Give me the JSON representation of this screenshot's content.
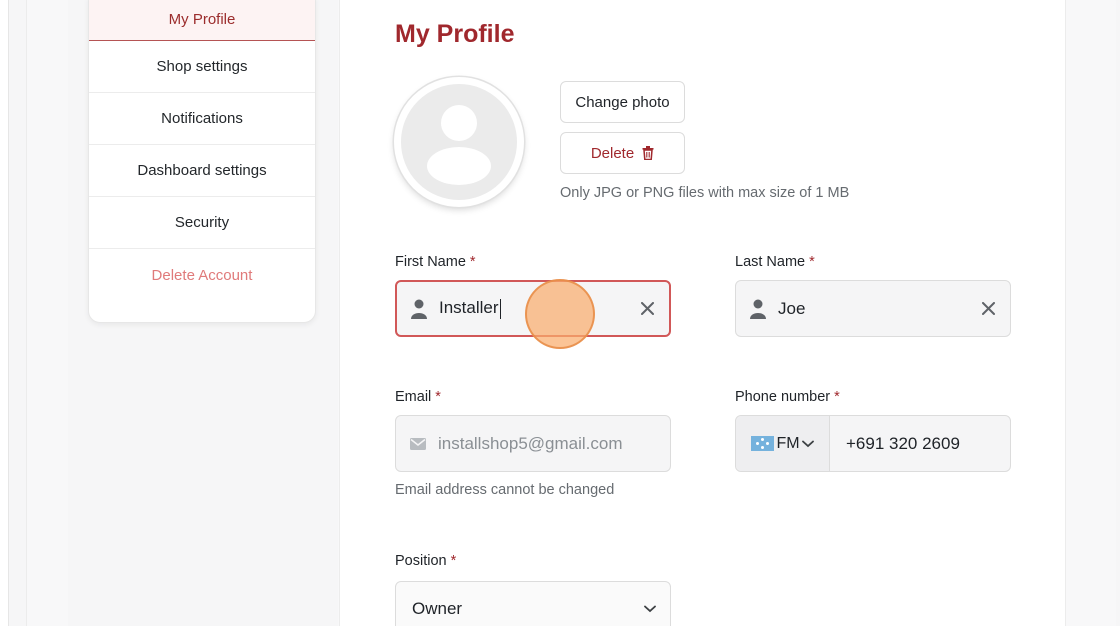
{
  "sidebar": {
    "items": [
      {
        "label": "My Profile"
      },
      {
        "label": "Shop settings"
      },
      {
        "label": "Notifications"
      },
      {
        "label": "Dashboard settings"
      },
      {
        "label": "Security"
      },
      {
        "label": "Delete Account"
      }
    ]
  },
  "main": {
    "title": "My Profile",
    "photo": {
      "change_label": "Change photo",
      "delete_label": "Delete",
      "hint": "Only JPG or PNG files with max size of 1 MB"
    },
    "first_name": {
      "label": "First Name",
      "required": "*",
      "value": "Installer"
    },
    "last_name": {
      "label": "Last Name",
      "required": "*",
      "value": "Joe"
    },
    "email": {
      "label": "Email",
      "required": "*",
      "value": "installshop5@gmail.com",
      "hint": "Email address cannot be changed"
    },
    "phone": {
      "label": "Phone number",
      "required": "*",
      "country_code": "FM",
      "value": "+691 320 2609"
    },
    "position": {
      "label": "Position",
      "required": "*",
      "value": "Owner"
    }
  },
  "colors": {
    "accent": "#a0282d",
    "danger_light": "#e07a7a",
    "focus_border": "#d15858",
    "click_indicator": "#faad6e"
  },
  "icons": {
    "person": "person-icon",
    "mail": "mail-icon",
    "clear": "close-icon",
    "trash": "trash-icon",
    "chevron": "chevron-down-icon"
  }
}
